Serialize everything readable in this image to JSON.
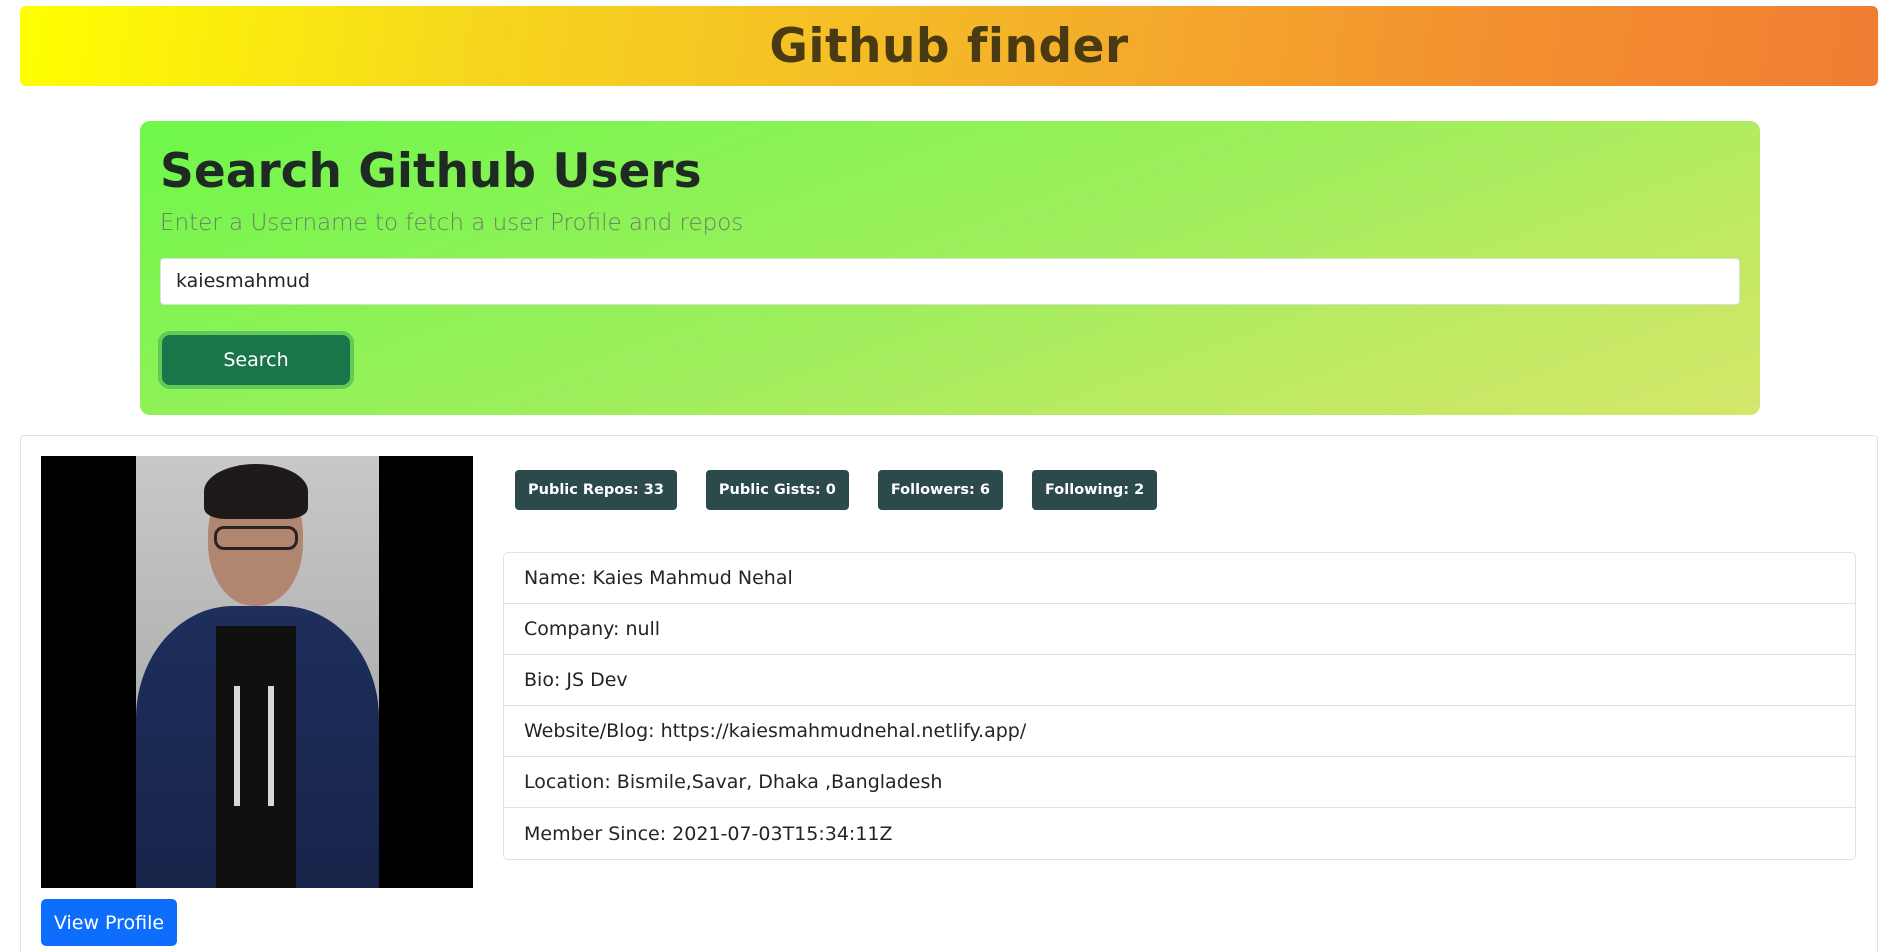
{
  "header": {
    "title": "Github finder"
  },
  "search": {
    "heading": "Search Github Users",
    "subtitle": "Enter a Username to fetch a user Profile and repos",
    "input_value": "kaiesmahmud",
    "button_label": "Search"
  },
  "profile": {
    "view_profile_label": "View Profile",
    "badges": [
      "Public Repos: 33",
      "Public Gists: 0",
      "Followers: 6",
      "Following: 2"
    ],
    "details": [
      "Name: Kaies Mahmud Nehal",
      "Company: null",
      "Bio: JS Dev",
      "Website/Blog: https://kaiesmahmudnehal.netlify.app/",
      "Location: Bismile,Savar, Dhaka ,Bangladesh",
      "Member Since: 2021-07-03T15:34:11Z"
    ]
  },
  "colors": {
    "badge_bg": "#2c4a4c",
    "view_profile_bg": "#0d6efd",
    "search_button_bg": "#1a7549"
  }
}
